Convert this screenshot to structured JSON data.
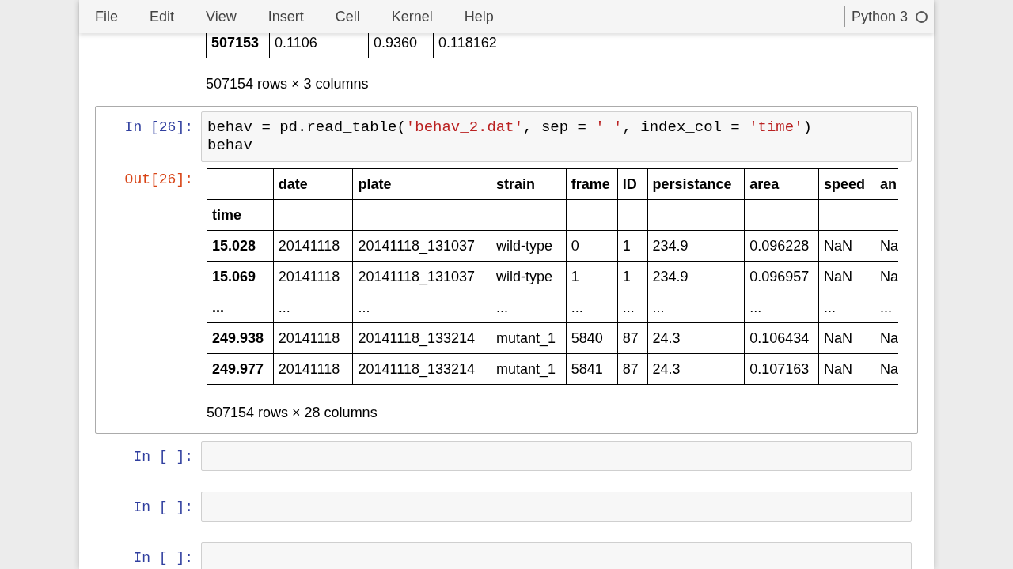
{
  "menu": [
    "File",
    "Edit",
    "View",
    "Insert",
    "Cell",
    "Kernel",
    "Help"
  ],
  "kernel": {
    "name": "Python 3",
    "busy": false
  },
  "cells": [
    {
      "kind": "output_tail",
      "rows": [
        [
          "507153",
          "0.1106",
          "0.9360",
          "0.118162"
        ]
      ],
      "summary": "507154 rows × 3 columns"
    },
    {
      "kind": "code",
      "selected": true,
      "prompt": "In [26]:",
      "code_lines": [
        [
          {
            "text": "behav = pd.read_table(",
            "kind": "plain"
          },
          {
            "text": "'behav_2.dat'",
            "kind": "string"
          },
          {
            "text": ", sep = ",
            "kind": "plain"
          },
          {
            "text": "' '",
            "kind": "string"
          },
          {
            "text": ", index_col = ",
            "kind": "plain"
          },
          {
            "text": "'time'",
            "kind": "string"
          },
          {
            "text": ")",
            "kind": "plain"
          }
        ],
        [
          {
            "text": "behav",
            "kind": "plain"
          }
        ]
      ],
      "output": {
        "prompt": "Out[26]:",
        "columns": [
          "",
          "date",
          "plate",
          "strain",
          "frame",
          "ID",
          "persistance",
          "area",
          "speed",
          "an"
        ],
        "index_name": "time",
        "rows": [
          [
            "15.028",
            "20141118",
            "20141118_131037",
            "wild-type",
            "0",
            "1",
            "234.9",
            "0.096228",
            "NaN",
            "Na"
          ],
          [
            "15.069",
            "20141118",
            "20141118_131037",
            "wild-type",
            "1",
            "1",
            "234.9",
            "0.096957",
            "NaN",
            "Na"
          ],
          [
            "...",
            "...",
            "...",
            "...",
            "...",
            "...",
            "...",
            "...",
            "...",
            "..."
          ],
          [
            "249.938",
            "20141118",
            "20141118_133214",
            "mutant_1",
            "5840",
            "87",
            "24.3",
            "0.106434",
            "NaN",
            "Na"
          ],
          [
            "249.977",
            "20141118",
            "20141118_133214",
            "mutant_1",
            "5841",
            "87",
            "24.3",
            "0.107163",
            "NaN",
            "Na"
          ]
        ],
        "summary": "507154 rows × 28 columns"
      }
    },
    {
      "kind": "code",
      "selected": false,
      "prompt": "In [ ]:"
    },
    {
      "kind": "code",
      "selected": false,
      "prompt": "In [ ]:"
    },
    {
      "kind": "code",
      "selected": false,
      "prompt": "In [ ]:"
    }
  ]
}
